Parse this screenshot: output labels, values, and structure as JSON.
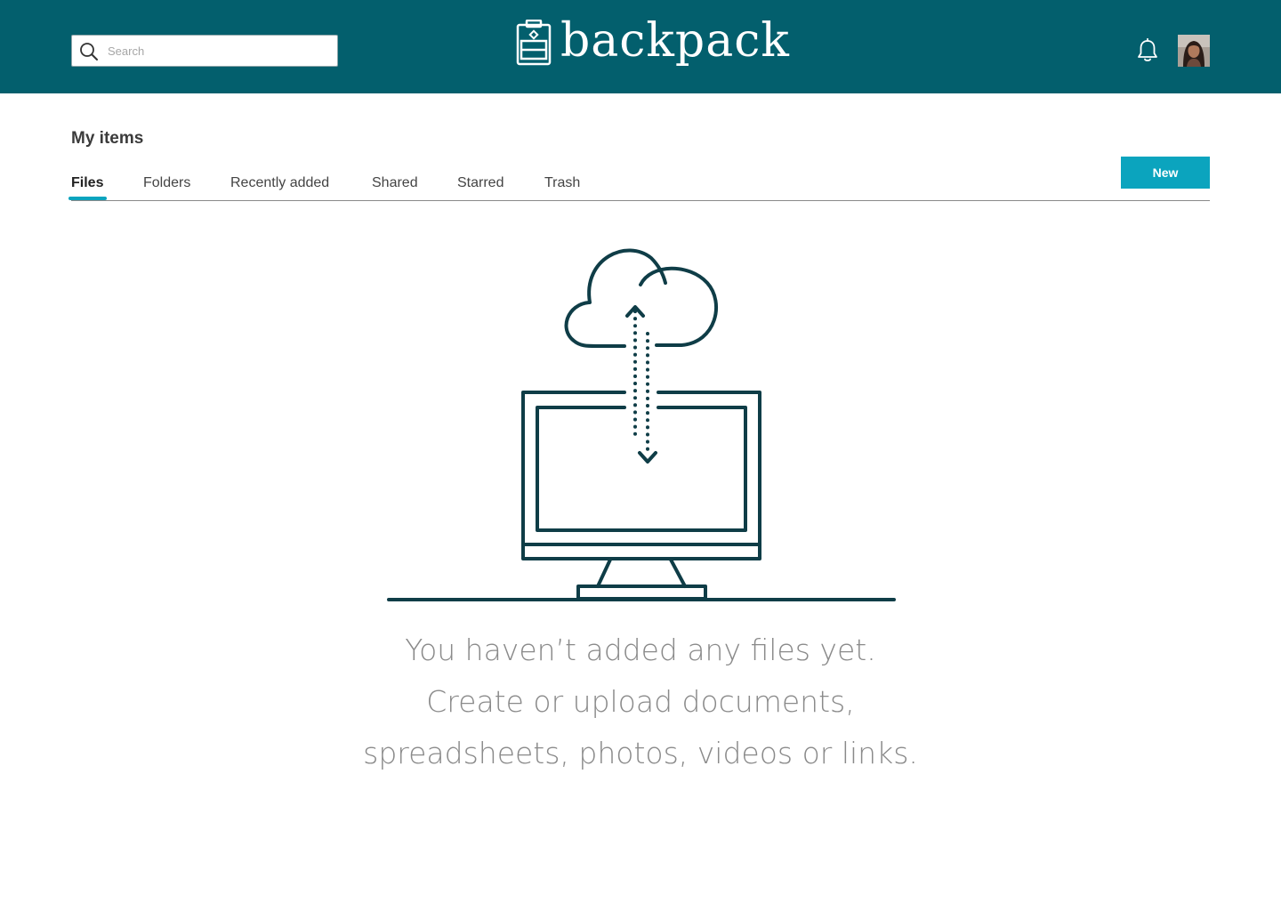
{
  "header": {
    "brand_name": "backpack",
    "brand_color": "#035F6D",
    "search": {
      "placeholder": "Search",
      "value": ""
    },
    "icons": [
      "search-icon",
      "backpack-logo-icon",
      "bell-icon",
      "user-avatar"
    ]
  },
  "page": {
    "title": "My items",
    "tabs": [
      {
        "label": "Files",
        "active": true
      },
      {
        "label": "Folders",
        "active": false
      },
      {
        "label": "Recently added",
        "active": false
      },
      {
        "label": "Shared",
        "active": false
      },
      {
        "label": "Starred",
        "active": false
      },
      {
        "label": "Trash",
        "active": false
      }
    ],
    "new_button_label": "New",
    "accent_color": "#0BA4BE"
  },
  "empty_state": {
    "illustration": "cloud-sync-computer-icon",
    "lines": [
      "You haven’t added any files yet.",
      "Create or upload documents,",
      "spreadsheets, photos, videos or links."
    ]
  }
}
